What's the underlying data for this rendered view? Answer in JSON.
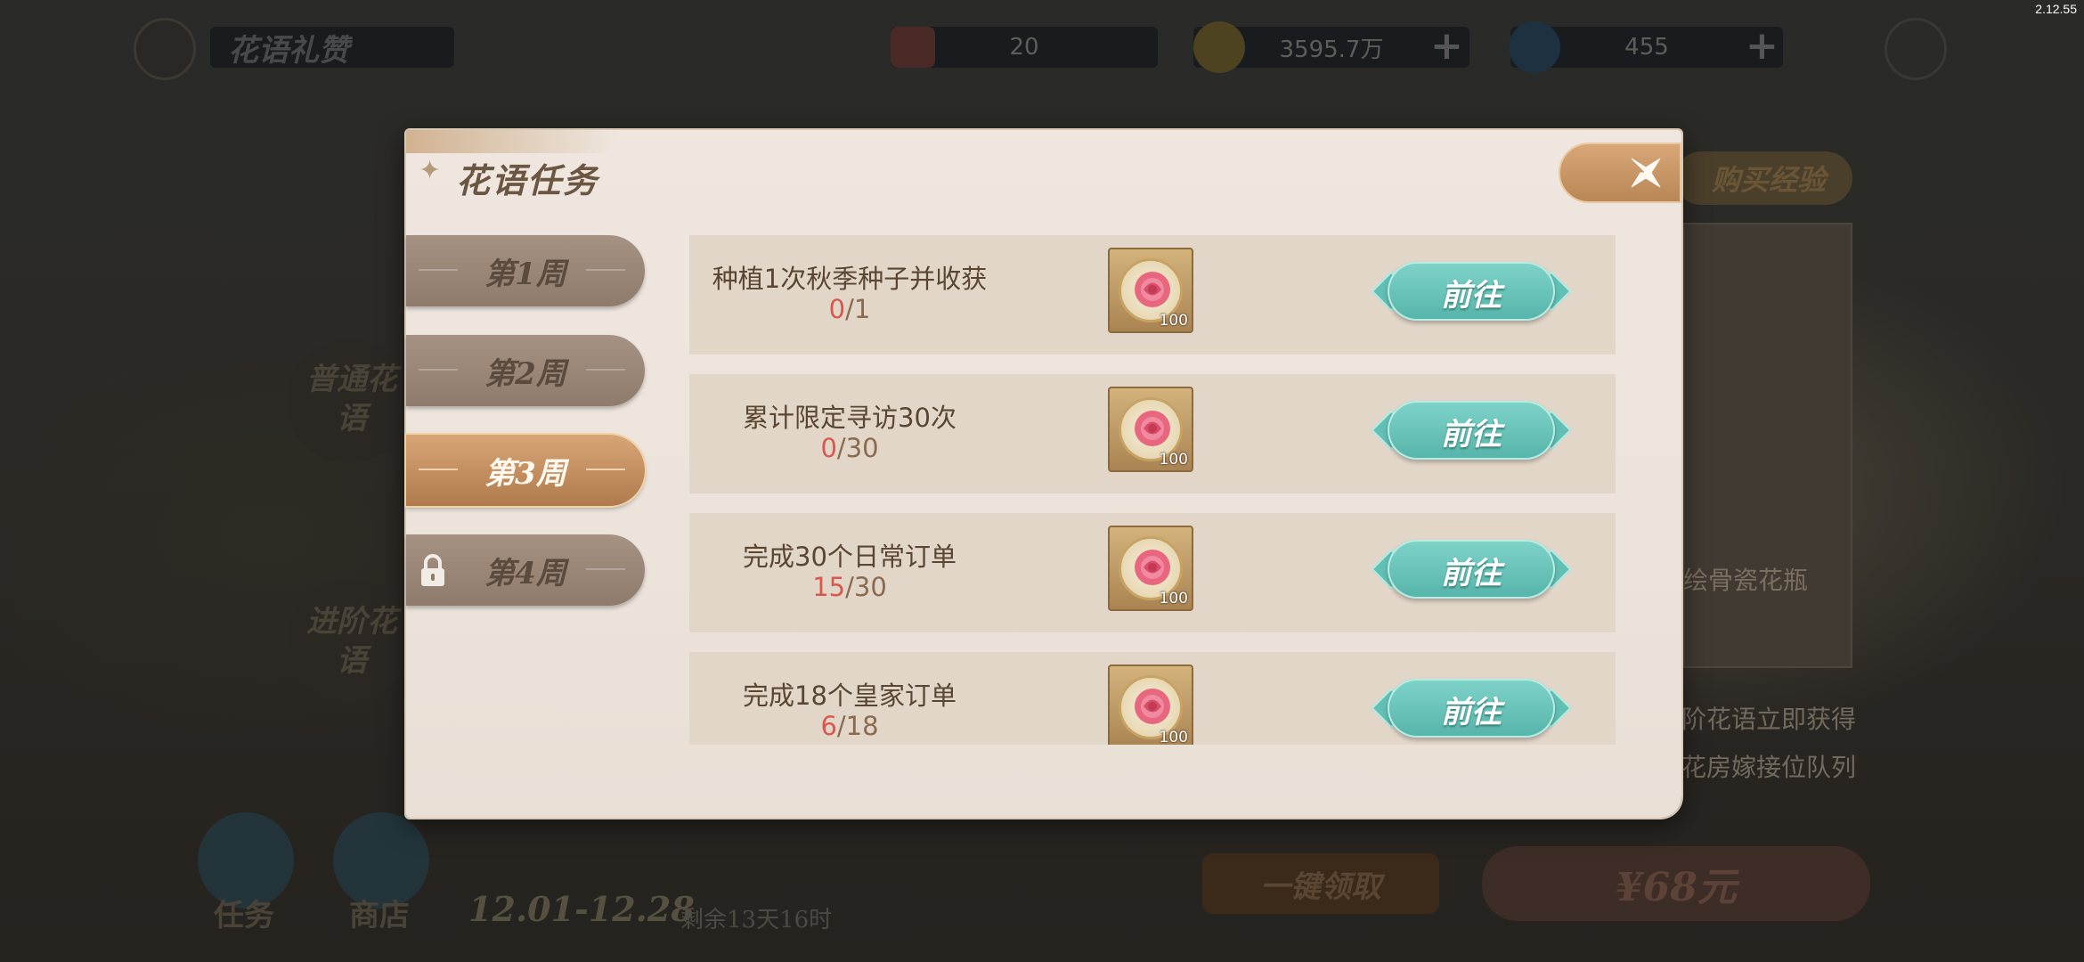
{
  "version": "2.12.55",
  "background": {
    "page_title": "花语礼赞",
    "resources": [
      {
        "name": "ticket",
        "value": "20"
      },
      {
        "name": "gold-coin",
        "value": "3595.7万"
      },
      {
        "name": "gem",
        "value": "455"
      }
    ],
    "left_tabs": [
      "普通花语",
      "进阶花语"
    ],
    "bottom_nav": [
      {
        "label": "任务"
      },
      {
        "label": "商店"
      }
    ],
    "date_range": "12.01-12.28",
    "remaining": "剩余13天16时",
    "buy_exp_label": "购买经验",
    "vase_label": "绘骨瓷花瓶",
    "promo_line1": "阶花语立即获得",
    "promo_line2": "花房嫁接位队列",
    "claim_all_label": "一键领取",
    "price_label": "¥68元"
  },
  "modal": {
    "title": "花语任务",
    "weeks": [
      {
        "label": "第1周",
        "state": "normal"
      },
      {
        "label": "第2周",
        "state": "normal"
      },
      {
        "label": "第3周",
        "state": "active"
      },
      {
        "label": "第4周",
        "state": "locked"
      }
    ],
    "tasks": [
      {
        "name": "种植1次秋季种子并收获",
        "current": "0",
        "total": "/1",
        "reward_qty": "100",
        "button": "前往"
      },
      {
        "name": "累计限定寻访30次",
        "current": "0",
        "total": "/30",
        "reward_qty": "100",
        "button": "前往"
      },
      {
        "name": "完成30个日常订单",
        "current": "15",
        "total": "/30",
        "reward_qty": "100",
        "button": "前往"
      },
      {
        "name": "完成18个皇家订单",
        "current": "6",
        "total": "/18",
        "reward_qty": "100",
        "button": "前往"
      }
    ]
  },
  "colors": {
    "active_tab": "#c18c5e",
    "go_button": "#6cc6bb",
    "progress_current": "#d9584e"
  }
}
